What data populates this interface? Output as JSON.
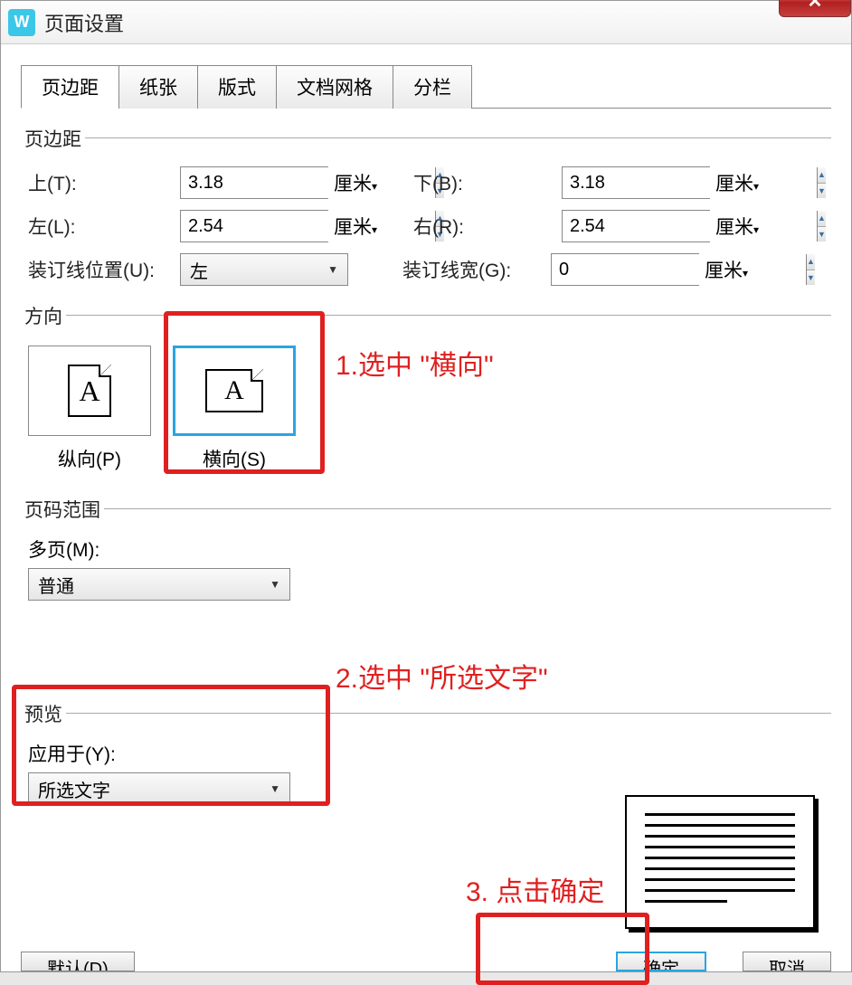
{
  "window": {
    "title": "页面设置"
  },
  "tabs": [
    "页边距",
    "纸张",
    "版式",
    "文档网格",
    "分栏"
  ],
  "margins": {
    "legend": "页边距",
    "top_label": "上(T):",
    "top_value": "3.18",
    "bottom_label": "下(B):",
    "bottom_value": "3.18",
    "left_label": "左(L):",
    "left_value": "2.54",
    "right_label": "右(R):",
    "right_value": "2.54",
    "unit": "厘米",
    "gutter_pos_label": "装订线位置(U):",
    "gutter_pos_value": "左",
    "gutter_width_label": "装订线宽(G):",
    "gutter_width_value": "0"
  },
  "orientation": {
    "legend": "方向",
    "portrait_label": "纵向(P)",
    "landscape_label": "横向(S)",
    "selected": "landscape"
  },
  "pages": {
    "legend": "页码范围",
    "multi_label": "多页(M):",
    "multi_value": "普通"
  },
  "preview": {
    "legend": "预览",
    "apply_label": "应用于(Y):",
    "apply_value": "所选文字"
  },
  "buttons": {
    "default": "默认(D)",
    "ok": "确定",
    "cancel": "取消"
  },
  "annotations": {
    "a1": "1.选中 \"横向\"",
    "a2": "2.选中 \"所选文字\"",
    "a3": "3. 点击确定"
  }
}
